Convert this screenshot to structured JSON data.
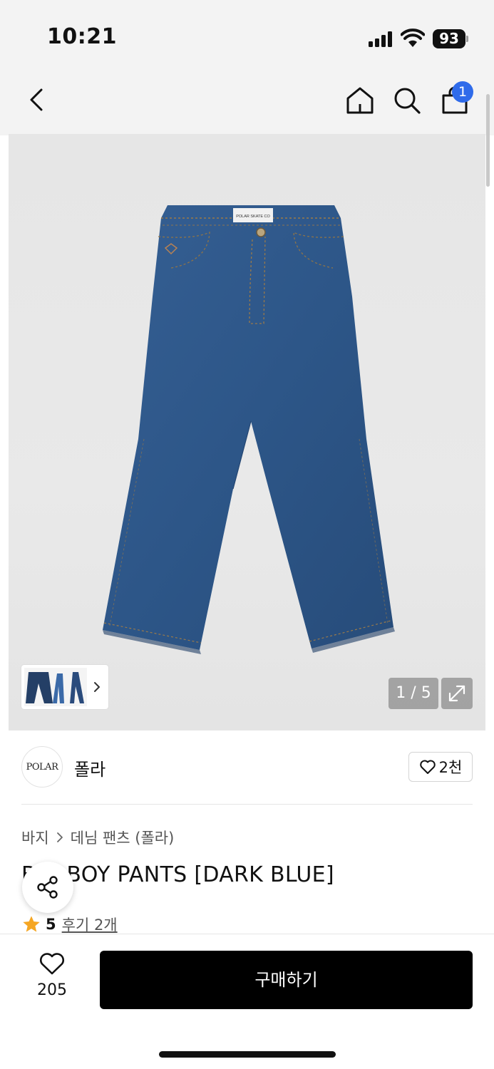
{
  "status_bar": {
    "time": "10:21",
    "battery": "93"
  },
  "nav": {
    "cart_badge": "1"
  },
  "gallery": {
    "counter": "1 / 5"
  },
  "brand": {
    "logo_text": "POLAR",
    "name": "폴라",
    "like_count": "2천"
  },
  "breadcrumb": {
    "category": "바지",
    "subcategory": "데님 팬츠 (폴라)"
  },
  "product": {
    "title": "BIG BOY PANTS [DARK BLUE]",
    "rating": "5",
    "reviews": "후기 2개"
  },
  "bottom_bar": {
    "wish_count": "205",
    "buy_label": "구매하기"
  },
  "colors": {
    "accent": "#2f6bea",
    "star": "#f5a623",
    "denim": "#2d5688"
  }
}
